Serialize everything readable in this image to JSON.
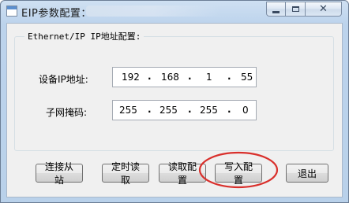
{
  "window": {
    "title": "EIP参数配置："
  },
  "titlebar_buttons": {
    "minimize": "minimize",
    "maximize": "maximize",
    "close": "close"
  },
  "group": {
    "title": "Ethernet/IP IP地址配置:"
  },
  "fields": {
    "ip": {
      "label": "设备IP地址:",
      "octets": [
        "192",
        "168",
        "1",
        "55"
      ]
    },
    "mask": {
      "label": "子网掩码:",
      "octets": [
        "255",
        "255",
        "255",
        "0"
      ]
    }
  },
  "buttons": {
    "connect_slave": "连接从站",
    "timed_read": "定时读取",
    "read_config": "读取配置",
    "write_config": "写入配置",
    "exit": "退出"
  },
  "colors": {
    "annotation_circle": "#d9302c"
  }
}
